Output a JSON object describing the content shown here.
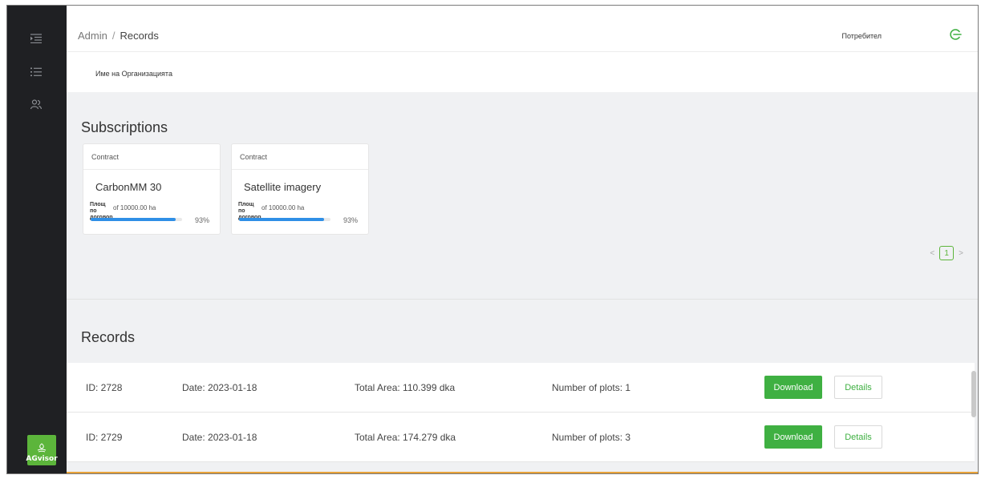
{
  "header": {
    "breadcrumb_root": "Admin",
    "breadcrumb_separator": "/",
    "breadcrumb_current": "Records",
    "user_name": "Потребител"
  },
  "organization": {
    "name": "Име на Организацията"
  },
  "sidebar": {
    "icons": [
      "menu-collapse-icon",
      "list-icon",
      "users-icon"
    ],
    "logo_text": "AGvisor"
  },
  "subscriptions": {
    "title": "Subscriptions",
    "cards": [
      {
        "header": "Contract",
        "title": "CarbonMM 30",
        "area_label": "Площ по договор",
        "area_value": "of 10000.00 ha",
        "percent_label": "93%",
        "percent": 93
      },
      {
        "header": "Contract",
        "title": "Satellite imagery",
        "area_label": "Площ по договор",
        "area_value": "of 10000.00 ha",
        "percent_label": "93%",
        "percent": 93
      }
    ],
    "pagination": {
      "prev": "<",
      "current": "1",
      "next": ">"
    }
  },
  "records": {
    "title": "Records",
    "rows": [
      {
        "id": "ID:  2728",
        "date": "Date:  2023-01-18",
        "area": "Total Area:  110.399 dka",
        "plots": "Number of plots:  1",
        "download_label": "Download",
        "details_label": "Details"
      },
      {
        "id": "ID:  2729",
        "date": "Date:  2023-01-18",
        "area": "Total Area:  174.279 dka",
        "plots": "Number of plots:  3",
        "download_label": "Download",
        "details_label": "Details"
      }
    ]
  },
  "colors": {
    "accent_green": "#3fb042",
    "progress_blue": "#2f8fe6",
    "sidebar_dark": "#1f2023"
  }
}
